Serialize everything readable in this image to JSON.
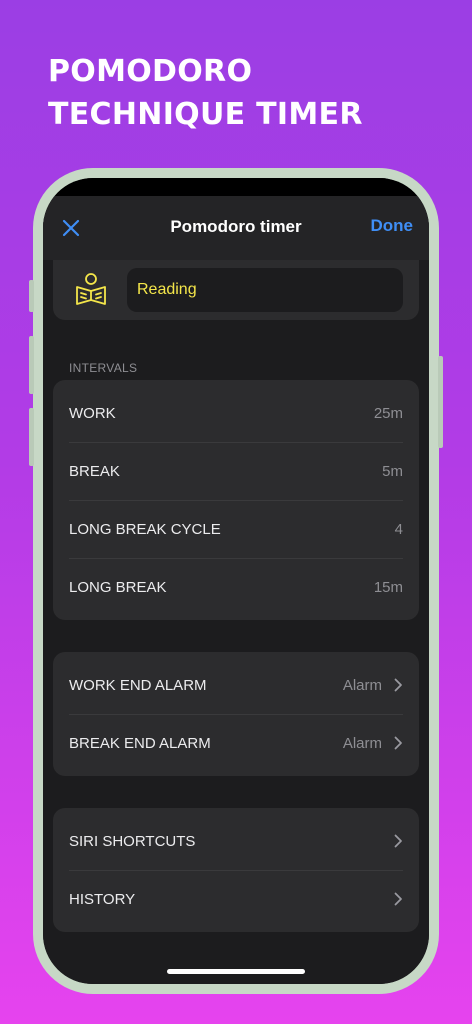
{
  "headline": {
    "line1": "POMODORO",
    "line2": "TECHNIQUE TIMER"
  },
  "nav": {
    "title": "Pomodoro timer",
    "done_label": "Done"
  },
  "timer_name": {
    "value": "Reading"
  },
  "intervals": {
    "section_label": "INTERVALS",
    "rows": [
      {
        "label": "WORK",
        "value": "25m"
      },
      {
        "label": "BREAK",
        "value": "5m"
      },
      {
        "label": "LONG BREAK CYCLE",
        "value": "4"
      },
      {
        "label": "LONG BREAK",
        "value": "15m"
      }
    ]
  },
  "alarms": {
    "rows": [
      {
        "label": "WORK END ALARM",
        "value": "Alarm"
      },
      {
        "label": "BREAK END ALARM",
        "value": "Alarm"
      }
    ]
  },
  "links": {
    "rows": [
      {
        "label": "SIRI SHORTCUTS"
      },
      {
        "label": "HISTORY"
      }
    ]
  },
  "colors": {
    "accent": "#3f8ef5",
    "name_text": "#f4e64a",
    "icon": "#f4e64a",
    "background_top": "#9b3ee4",
    "background_bottom": "#e643ee"
  },
  "icons": {
    "close": "close-icon",
    "timer_type": "book-reader-icon",
    "disclosure": "chevron-right-icon"
  }
}
